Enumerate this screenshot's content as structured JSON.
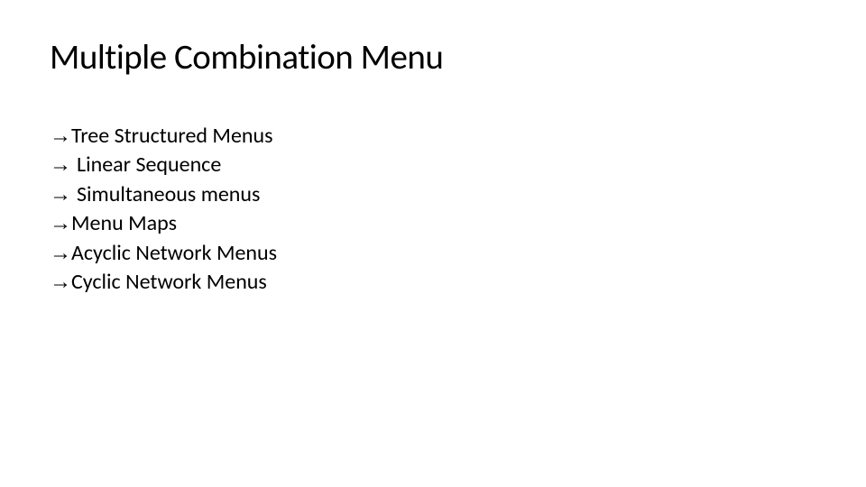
{
  "slide": {
    "title": "Multiple Combination Menu",
    "bullets": [
      {
        "arrow": "→",
        "text": "Tree Structured Menus",
        "spaced": false
      },
      {
        "arrow": "→",
        "text": "Linear Sequence",
        "spaced": true
      },
      {
        "arrow": "→",
        "text": "Simultaneous menus",
        "spaced": true
      },
      {
        "arrow": "→",
        "text": "Menu Maps",
        "spaced": false
      },
      {
        "arrow": "→",
        "text": "Acyclic Network Menus",
        "spaced": false
      },
      {
        "arrow": "→",
        "text": "Cyclic Network Menus",
        "spaced": false
      }
    ]
  }
}
